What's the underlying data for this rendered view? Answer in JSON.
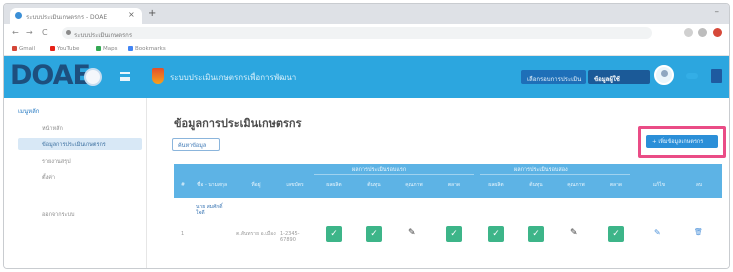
{
  "browser": {
    "tab_title": "ระบบประเมินเกษตรกร - DOAE",
    "tab_close": "×",
    "new_tab": "+",
    "window_minimize": "–",
    "back": "←",
    "forward": "→",
    "reload": "C",
    "url": "ระบบประเมินเกษตรกร",
    "bookmarks": [
      "Gmail",
      "YouTube",
      "Maps",
      "Bookmarks"
    ],
    "bookmark_colors": [
      "#d44638",
      "#e62117",
      "#34a853",
      "#4285f4"
    ]
  },
  "header": {
    "logo": "DOAE",
    "app_title": "ระบบประเมินเกษตรกรเพื่อการพัฒนา",
    "button_1": "เลือกรอบการประเมิน",
    "button_2": "ข้อมูลผู้ใช้",
    "brand_color": "#2ca6df"
  },
  "sidebar": {
    "title": "เมนูหลัก",
    "items": [
      {
        "label": "หน้าหลัก",
        "active": false
      },
      {
        "label": "ข้อมูลการประเมินเกษตรกร",
        "active": true
      },
      {
        "label": "รายงานสรุป",
        "active": false
      },
      {
        "label": "ตั้งค่า",
        "active": false
      },
      {
        "label": "ออกจากระบบ",
        "active": false
      }
    ]
  },
  "main": {
    "page_title": "ข้อมูลการประเมินเกษตรกร",
    "search_button": "ค้นหาข้อมูล",
    "add_button": "+ เพิ่มข้อมูลเกษตรกร",
    "highlight_color": "#ea4c86",
    "table": {
      "group_1": "ผลการประเมินรอบแรก",
      "group_2": "ผลการประเมินรอบสอง",
      "columns": [
        "#",
        "ชื่อ - นามสกุล",
        "ที่อยู่",
        "เลขบัตร",
        "ผลผลิต",
        "ต้นทุน",
        "คุณภาพ",
        "ตลาด",
        "ผลผลิต",
        "ต้นทุน",
        "คุณภาพ",
        "ตลาด",
        "แก้ไข",
        "ลบ"
      ],
      "row": {
        "index": "1",
        "name": "นาย สมศักดิ์ ใจดี",
        "address": "ต.สันทราย อ.เมือง",
        "id": "1-2345-67890",
        "status_icons": [
          "check",
          "check",
          "pencil",
          "check",
          "check",
          "check",
          "pencil",
          "check"
        ],
        "edit_icon": "✎",
        "delete_icon": "🗑"
      }
    }
  }
}
